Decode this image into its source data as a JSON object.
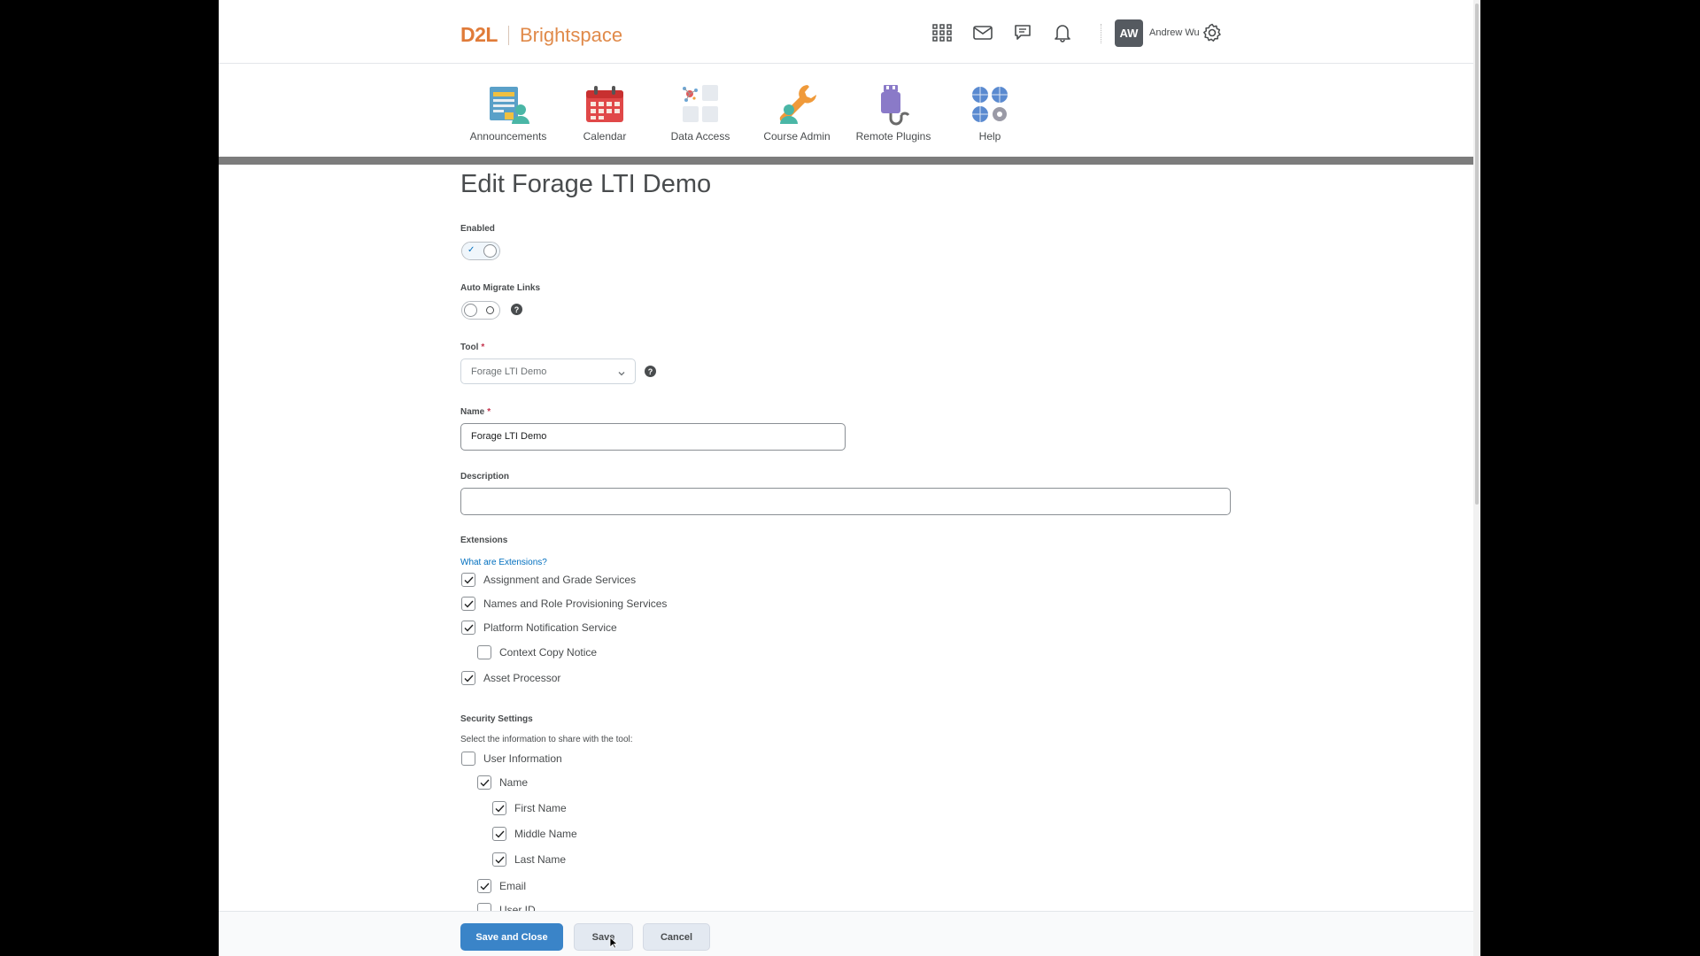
{
  "brand": {
    "logo_main": "D2L",
    "logo_product": "Brightspace"
  },
  "header": {
    "icons": [
      "grid-icon",
      "mail-icon",
      "chat-icon",
      "bell-icon",
      "gear-icon"
    ],
    "user_initials": "AW",
    "user_name": "Andrew Wu"
  },
  "nav": {
    "items": [
      {
        "label": "Announcements",
        "icon": "announcements-icon"
      },
      {
        "label": "Calendar",
        "icon": "calendar-icon"
      },
      {
        "label": "Data Access",
        "icon": "data-access-icon"
      },
      {
        "label": "Course Admin",
        "icon": "course-admin-icon"
      },
      {
        "label": "Remote Plugins",
        "icon": "remote-plugins-icon"
      },
      {
        "label": "Help",
        "icon": "help-icon"
      }
    ]
  },
  "form": {
    "title": "Edit Forage LTI Demo",
    "enabled_label": "Enabled",
    "enabled": true,
    "auto_migrate_label": "Auto Migrate Links",
    "auto_migrate": false,
    "tool_label": "Tool",
    "tool_value": "Forage LTI Demo",
    "name_label": "Name",
    "name_value": "Forage LTI Demo",
    "description_label": "Description",
    "description_value": "",
    "required_mark": "*",
    "extensions_label": "Extensions",
    "extensions_link": "What are Extensions?",
    "extensions": [
      {
        "label": "Assignment and Grade Services",
        "checked": true
      },
      {
        "label": "Names and Role Provisioning Services",
        "checked": true
      },
      {
        "label": "Platform Notification Service",
        "checked": true
      },
      {
        "label": "Context Copy Notice",
        "checked": false
      },
      {
        "label": "Asset Processor",
        "checked": true
      }
    ],
    "security_label": "Security Settings",
    "security_hint": "Select the information to share with the tool:",
    "security": [
      {
        "label": "User Information",
        "checked": false
      },
      {
        "label": "Name",
        "checked": true
      },
      {
        "label": "First Name",
        "checked": true
      },
      {
        "label": "Middle Name",
        "checked": true
      },
      {
        "label": "Last Name",
        "checked": true
      },
      {
        "label": "Email",
        "checked": true
      },
      {
        "label": "User ID",
        "checked": false
      }
    ]
  },
  "footer": {
    "save_close_label": "Save and Close",
    "save_label": "Save",
    "cancel_label": "Cancel"
  },
  "colors": {
    "brand_orange": "#e07b39",
    "primary_blue": "#3a84c8",
    "link_blue": "#006fbf"
  }
}
